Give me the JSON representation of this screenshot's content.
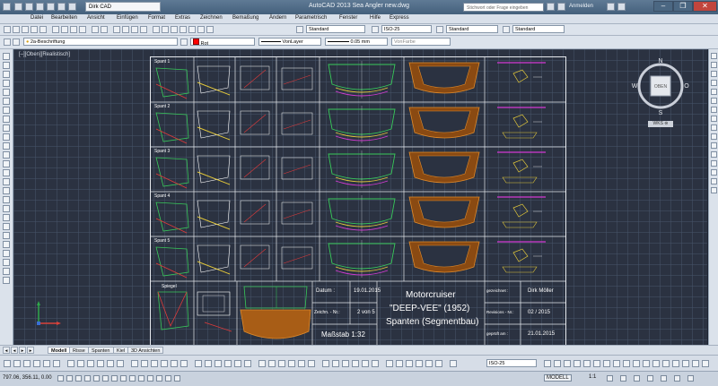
{
  "window": {
    "title": "AutoCAD 2013    Sea Angler new.dwg",
    "workspace": "Dirk CAD",
    "search_placeholder": "Stichwort oder Frage eingeben",
    "login": "Anmelden"
  },
  "menu": [
    "Datei",
    "Bearbeiten",
    "Ansicht",
    "Einfügen",
    "Format",
    "Extras",
    "Zeichnen",
    "Bemaßung",
    "Ändern",
    "Parametrisch",
    "Fenster",
    "Hilfe",
    "Express"
  ],
  "toolbar1": {
    "style1": "Standard",
    "dimstyle": "ISO-25",
    "style2": "Standard",
    "style3": "Standard"
  },
  "toolbar2": {
    "layer": "2a-Beschriftung",
    "color": "Rot",
    "linetype": "VonLayer",
    "lineweight": "0.05 mm",
    "plotstyle": "VonFarbe"
  },
  "view_label": "[–][Oben][Realistisch]",
  "viewcube": {
    "face": "OBEN",
    "n": "N",
    "s": "S",
    "w": "W",
    "e": "O",
    "wks": "WKS ⊜"
  },
  "drawing": {
    "rows": [
      "Spant 1",
      "Spant 2",
      "Spant 3",
      "Spant 4",
      "Spant 5"
    ],
    "spiegel": "Spiegel",
    "title_block": {
      "datum_label": "Datum :",
      "datum_value": "19.01.2015",
      "zeichn_label": "Zeichn. - Nr.:",
      "zeichn_value": "2 von 5",
      "massstab": "Maßstab 1:32",
      "title1": "Motorcruiser",
      "title2": "\"DEEP-VEE\" (1952)",
      "title3": "Spanten (Segmentbau)",
      "gezeichnet_label": "gezeichnet :",
      "gezeichnet_value": "Dirk Möller",
      "revision_label": "Revisions - Nr.:",
      "revision_value": "02 / 2015",
      "geprueft_label": "geprüft am :",
      "geprueft_value": "21.01.2015"
    }
  },
  "tabs": [
    "Modell",
    "Risse",
    "Spanten",
    "Kiel",
    "3D Ansichten"
  ],
  "status": {
    "coords": "797.06, 356.11, 0.00",
    "dimstyle": "ISO-25",
    "mode": "MODELL",
    "scale": "1:1"
  }
}
